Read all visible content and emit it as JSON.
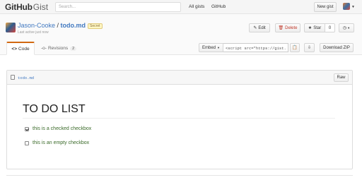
{
  "topbar": {
    "logo_github": "GitHub",
    "logo_gist": "Gist",
    "search_placeholder": "Search...",
    "links": [
      "All gists",
      "GitHub"
    ],
    "new_gist": "New gist"
  },
  "gist": {
    "owner": "Jason-Cooke",
    "separator": " / ",
    "filename": "todo.md",
    "secret_badge": "Secret",
    "last_active": "Last active just now",
    "actions": {
      "edit": "Edit",
      "delete": "Delete",
      "star": "Star",
      "star_count": "0"
    }
  },
  "tabs": {
    "code": "Code",
    "revisions": "Revisions",
    "revisions_count": "2"
  },
  "toolbar": {
    "embed": "Embed",
    "embed_value": "<script src=\"https://gist.",
    "download": "Download ZIP"
  },
  "file": {
    "name": "todo.md",
    "raw": "Raw",
    "heading": "TO DO LIST",
    "tasks": [
      {
        "label": "this is a checked checkbox",
        "checked": true
      },
      {
        "label": "this is an empty checkbox",
        "checked": false
      }
    ]
  }
}
